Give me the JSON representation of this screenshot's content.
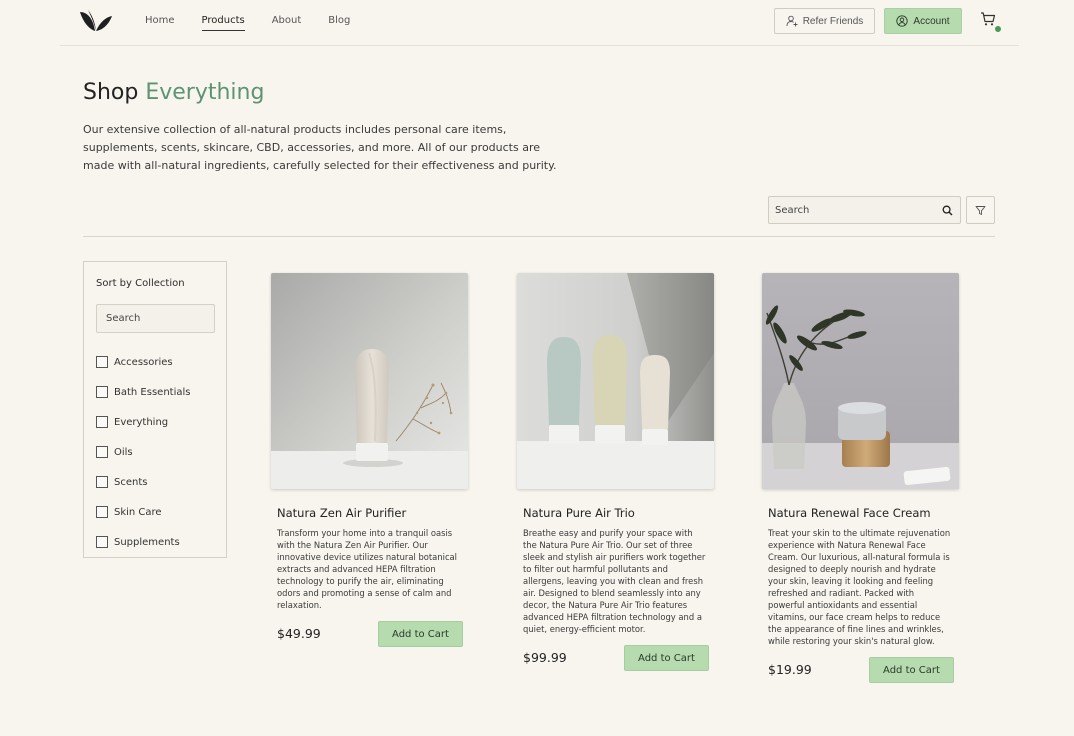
{
  "nav": {
    "items": [
      {
        "label": "Home"
      },
      {
        "label": "Products"
      },
      {
        "label": "About"
      },
      {
        "label": "Blog"
      }
    ],
    "active": "Products",
    "refer_label": "Refer Friends",
    "account_label": "Account",
    "icons": [
      "logo-leaf-icon",
      "user-plus-icon",
      "user-circle-icon",
      "cart-icon"
    ]
  },
  "hero": {
    "title_plain": "Shop",
    "title_accent": "Everything",
    "description": "Our extensive collection of all-natural products includes personal care items, supplements, scents, skincare, CBD, accessories, and more. All of our products are made with all-natural ingredients, carefully selected for their effectiveness and purity."
  },
  "toolbar": {
    "search_placeholder": "Search"
  },
  "sidebar": {
    "title": "Sort by Collection",
    "search_placeholder": "Search",
    "collections": [
      {
        "label": "Accessories",
        "checked": false
      },
      {
        "label": "Bath Essentials",
        "checked": false
      },
      {
        "label": "Everything",
        "checked": false
      },
      {
        "label": "Oils",
        "checked": false
      },
      {
        "label": "Scents",
        "checked": false
      },
      {
        "label": "Skin Care",
        "checked": false
      },
      {
        "label": "Supplements",
        "checked": false
      }
    ]
  },
  "products": [
    {
      "name": "Natura Zen Air Purifier",
      "description": "Transform your home into a tranquil oasis with the Natura Zen Air Purifier. Our innovative device utilizes natural botanical extracts and advanced HEPA filtration technology to purify the air, eliminating odors and promoting a sense of calm and relaxation.",
      "price": "$49.99",
      "button": "Add to Cart"
    },
    {
      "name": "Natura Pure Air Trio",
      "description": "Breathe easy and purify your space with the Natura Pure Air Trio. Our set of three sleek and stylish air purifiers work together to filter out harmful pollutants and allergens, leaving you with clean and fresh air. Designed to blend seamlessly into any decor, the Natura Pure Air Trio features advanced HEPA filtration technology and a quiet, energy-efficient motor.",
      "price": "$99.99",
      "button": "Add to Cart"
    },
    {
      "name": "Natura Renewal Face Cream",
      "description": "Treat your skin to the ultimate rejuvenation experience with Natura Renewal Face Cream. Our luxurious, all-natural formula is designed to deeply nourish and hydrate your skin, leaving it looking and feeling refreshed and radiant. Packed with powerful antioxidants and essential vitamins, our face cream helps to reduce the appearance of fine lines and wrinkles, while restoring your skin's natural glow.",
      "price": "$19.99",
      "button": "Add to Cart"
    }
  ],
  "colors": {
    "background": "#f8f5ee",
    "accent_green": "#5c9473",
    "button_green": "#b5dbae",
    "cart_dot": "#4a9a55"
  }
}
